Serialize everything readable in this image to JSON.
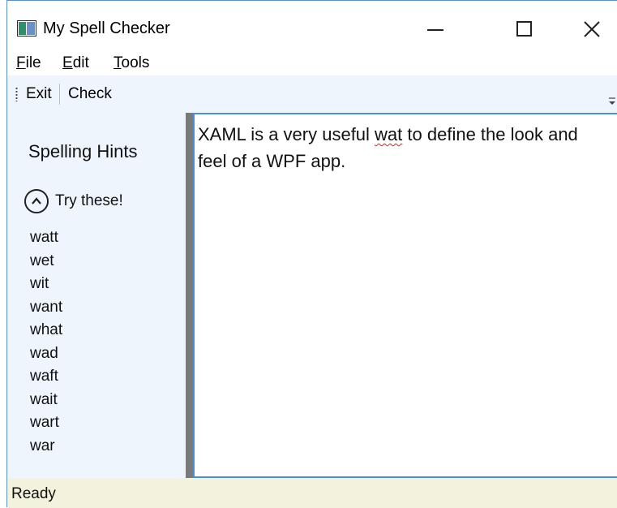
{
  "window": {
    "title": "My Spell Checker",
    "icon": "app-window-icon"
  },
  "caption_buttons": {
    "minimize_icon": "minimize-icon",
    "maximize_icon": "maximize-icon",
    "close_icon": "close-icon"
  },
  "menu": {
    "items": [
      {
        "label": "File",
        "access_key": "F",
        "rest": "ile"
      },
      {
        "label": "Edit",
        "access_key": "E",
        "rest": "dit"
      },
      {
        "label": "Tools",
        "access_key": "T",
        "rest": "ools"
      }
    ]
  },
  "toolbar": {
    "exit_label": "Exit",
    "check_label": "Check",
    "overflow_icon": "chevron-down-icon"
  },
  "sidebar": {
    "title": "Spelling Hints",
    "expander_label": "Try these!",
    "expander_icon": "chevron-up-icon",
    "suggestions": [
      "watt",
      "wet",
      "wit",
      "want",
      "what",
      "wad",
      "waft",
      "wait",
      "wart",
      "war"
    ]
  },
  "editor": {
    "text_before": "XAML is a very useful ",
    "misspelled_word": "wat",
    "text_after": " to define the look and feel of a WPF app."
  },
  "status": {
    "text": "Ready"
  },
  "colors": {
    "panel_background": "#eef5fd",
    "status_background": "#f3f2dc",
    "splitter": "#7a7a7a",
    "editor_border": "#4b8ee0",
    "spelling_error": "#e02020"
  }
}
